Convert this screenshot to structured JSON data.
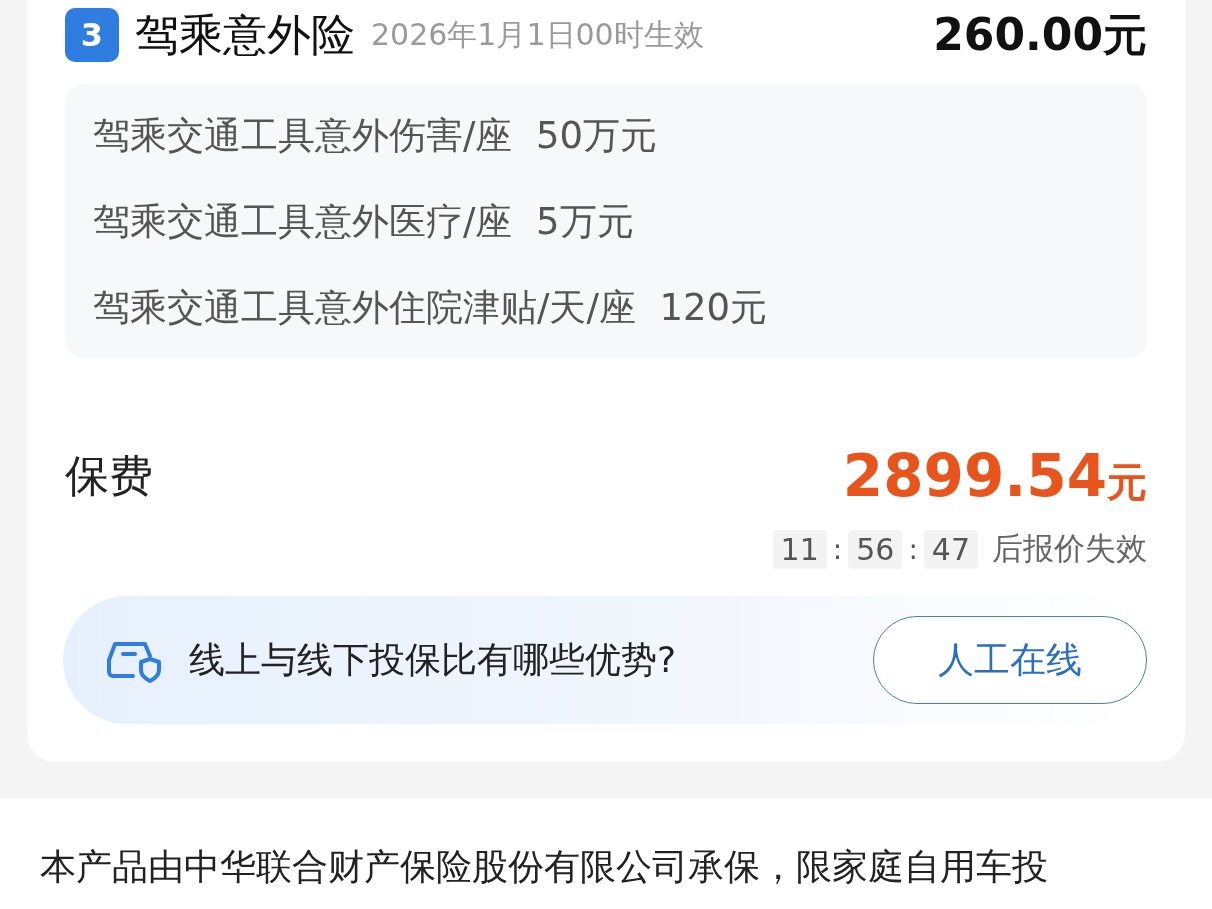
{
  "plan": {
    "number": "3",
    "name": "驾乘意外险",
    "effective": "2026年1月1日00时生效",
    "price": "260.00元"
  },
  "coverages": [
    {
      "name": "驾乘交通工具意外伤害/座",
      "amount": "50万元"
    },
    {
      "name": "驾乘交通工具意外医疗/座",
      "amount": "5万元"
    },
    {
      "name": "驾乘交通工具意外住院津贴/天/座",
      "amount": "120元"
    }
  ],
  "premium": {
    "label": "保费",
    "amount": "2899.54",
    "unit": "元"
  },
  "countdown": {
    "parts": [
      {
        "kind": "digits",
        "text": "11"
      },
      {
        "kind": "separator",
        "text": ":"
      },
      {
        "kind": "digits",
        "text": "56"
      },
      {
        "kind": "separator",
        "text": ":"
      },
      {
        "kind": "digits",
        "text": "47"
      }
    ],
    "suffix": "后报价失效"
  },
  "help_banner": {
    "question": "线上与线下投保比有哪些优势?",
    "button": "人工在线"
  },
  "footer_text": "本产品由中华联合财产保险股份有限公司承保，限家庭自用车投"
}
